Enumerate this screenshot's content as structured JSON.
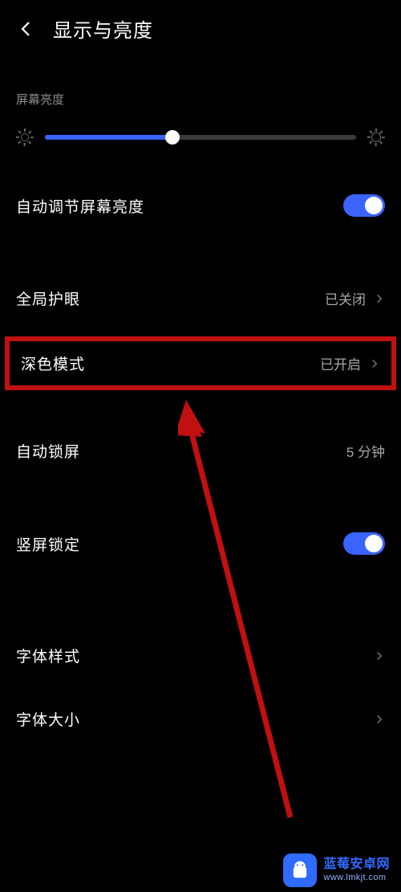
{
  "header": {
    "title": "显示与亮度"
  },
  "section": {
    "brightness_label": "屏幕亮度"
  },
  "brightness": {
    "percent": 41
  },
  "rows": {
    "auto_brightness": {
      "label": "自动调节屏幕亮度",
      "on": true
    },
    "eye_care": {
      "label": "全局护眼",
      "value": "已关闭"
    },
    "dark_mode": {
      "label": "深色模式",
      "value": "已开启"
    },
    "auto_lock": {
      "label": "自动锁屏",
      "value": "5 分钟"
    },
    "orientation_lock": {
      "label": "竖屏锁定",
      "on": true
    },
    "font_style": {
      "label": "字体样式"
    },
    "font_size": {
      "label": "字体大小"
    }
  },
  "watermark": {
    "title": "蓝莓安卓网",
    "url": "www.lmkjt.com"
  },
  "colors": {
    "accent": "#3a63ff",
    "highlight": "#c01010"
  }
}
